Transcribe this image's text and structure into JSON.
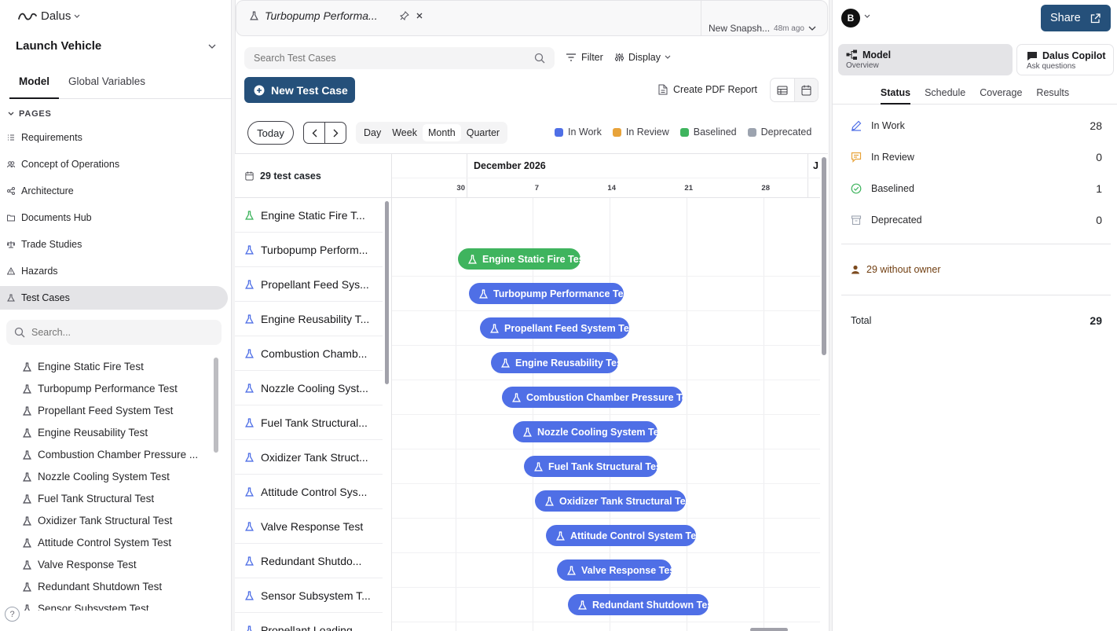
{
  "app": {
    "brand": "Dalus",
    "project": "Launch Vehicle"
  },
  "sidebar": {
    "tabs": [
      "Model",
      "Global Variables"
    ],
    "pages_heading": "PAGES",
    "pages": [
      {
        "label": "Requirements",
        "icon": "list-icon"
      },
      {
        "label": "Concept of Operations",
        "icon": "people-icon"
      },
      {
        "label": "Architecture",
        "icon": "network-icon"
      },
      {
        "label": "Documents Hub",
        "icon": "folder-icon"
      },
      {
        "label": "Trade Studies",
        "icon": "scale-icon"
      },
      {
        "label": "Hazards",
        "icon": "warning-icon"
      },
      {
        "label": "Test Cases",
        "icon": "flask-icon"
      }
    ],
    "search_placeholder": "Search...",
    "tests": [
      "Engine Static Fire Test",
      "Turbopump Performance Test",
      "Propellant Feed System Test",
      "Engine Reusability Test",
      "Combustion Chamber Pressure ...",
      "Nozzle Cooling System Test",
      "Fuel Tank Structural Test",
      "Oxidizer Tank Structural Test",
      "Attitude Control System Test",
      "Valve Response Test",
      "Redundant Shutdown Test",
      "Sensor Subsystem Test"
    ],
    "help": "?"
  },
  "doc_tab": {
    "title": "Turbopump Performa...",
    "snapshot": "New Snapsh...",
    "snapshot_age": "48m ago"
  },
  "toolbar": {
    "search_placeholder": "Search Test Cases",
    "filter": "Filter",
    "display": "Display",
    "new_test": "New Test Case",
    "pdf": "Create PDF Report"
  },
  "calendar": {
    "today": "Today",
    "ranges": [
      "Day",
      "Week",
      "Month",
      "Quarter"
    ],
    "active_range": "Month",
    "legend": [
      {
        "label": "In Work",
        "color": "#4f6fe6"
      },
      {
        "label": "In Review",
        "color": "#e8a33a"
      },
      {
        "label": "Baselined",
        "color": "#3fb45e"
      },
      {
        "label": "Deprecated",
        "color": "#9ca3af"
      }
    ],
    "count_label": "29 test cases",
    "month": "December 2026",
    "next_month_initial": "J",
    "days": [
      "30",
      "7",
      "14",
      "21",
      "28"
    ]
  },
  "rows": [
    {
      "name": "Engine Static Fire T...",
      "status": "Baselined"
    },
    {
      "name": "Turbopump Perform...",
      "status": "In Work"
    },
    {
      "name": "Propellant Feed Sys...",
      "status": "In Work"
    },
    {
      "name": "Engine Reusability T...",
      "status": "In Work"
    },
    {
      "name": "Combustion Chamb...",
      "status": "In Work"
    },
    {
      "name": "Nozzle Cooling Syst...",
      "status": "In Work"
    },
    {
      "name": "Fuel Tank Structural...",
      "status": "In Work"
    },
    {
      "name": "Oxidizer Tank Struct...",
      "status": "In Work"
    },
    {
      "name": "Attitude Control Sys...",
      "status": "In Work"
    },
    {
      "name": "Valve Response Test",
      "status": "In Work"
    },
    {
      "name": "Redundant Shutdo...",
      "status": "In Work"
    },
    {
      "name": "Sensor Subsystem T...",
      "status": "In Work"
    },
    {
      "name": "Propellant Loading ...",
      "status": "In Work"
    }
  ],
  "bars": [
    {
      "label": "Engine Static Fire Test",
      "status": "Baselined"
    },
    {
      "label": "Turbopump Performance Test",
      "status": "In Work"
    },
    {
      "label": "Propellant Feed System Test",
      "status": "In Work"
    },
    {
      "label": "Engine Reusability Test",
      "status": "In Work"
    },
    {
      "label": "Combustion Chamber Pressure Test",
      "status": "In Work"
    },
    {
      "label": "Nozzle Cooling System Test",
      "status": "In Work"
    },
    {
      "label": "Fuel Tank Structural Test",
      "status": "In Work"
    },
    {
      "label": "Oxidizer Tank Structural Test",
      "status": "In Work"
    },
    {
      "label": "Attitude Control System Test",
      "status": "In Work"
    },
    {
      "label": "Valve Response Test",
      "status": "In Work"
    },
    {
      "label": "Redundant Shutdown Test",
      "status": "In Work"
    }
  ],
  "right": {
    "user_initial": "B",
    "share": "Share",
    "modes": [
      {
        "title": "Model",
        "sub": "Overview"
      },
      {
        "title": "Dalus Copilot",
        "sub": "Ask questions"
      }
    ],
    "tabs": [
      "Status",
      "Schedule",
      "Coverage",
      "Results"
    ],
    "stats": [
      {
        "label": "In Work",
        "value": "28",
        "icon": "pencil-icon"
      },
      {
        "label": "In Review",
        "value": "0",
        "icon": "comment-icon"
      },
      {
        "label": "Baselined",
        "value": "1",
        "icon": "check-circle-icon"
      },
      {
        "label": "Deprecated",
        "value": "0",
        "icon": "archive-icon"
      }
    ],
    "owner_note": "29 without owner",
    "total_label": "Total",
    "total_value": "29"
  }
}
